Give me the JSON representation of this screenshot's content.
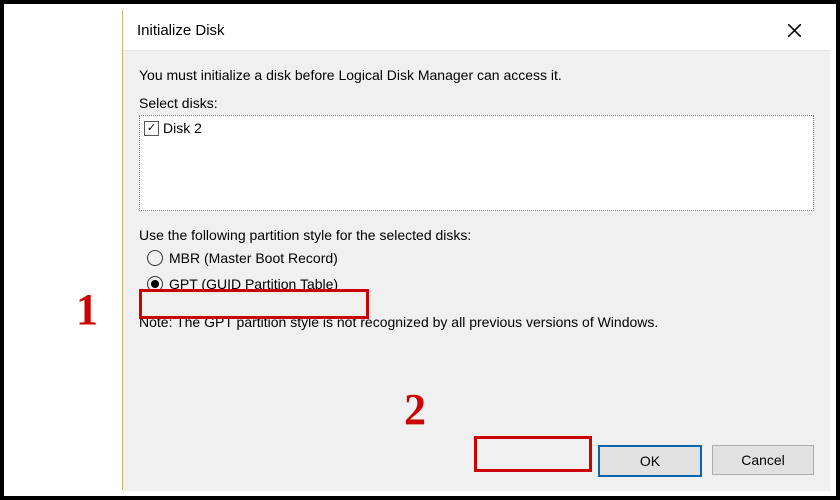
{
  "dialog": {
    "title": "Initialize Disk",
    "instruction": "You must initialize a disk before Logical Disk Manager can access it.",
    "select_label": "Select disks:",
    "disks": [
      {
        "label": "Disk 2",
        "checked": true
      }
    ],
    "partition_label": "Use the following partition style for the selected disks:",
    "radios": {
      "mbr": "MBR (Master Boot Record)",
      "gpt": "GPT (GUID Partition Table)"
    },
    "note": "Note: The GPT partition style is not recognized by all previous versions of Windows.",
    "ok_label": "OK",
    "cancel_label": "Cancel"
  },
  "annotations": {
    "one": "1",
    "two": "2"
  }
}
